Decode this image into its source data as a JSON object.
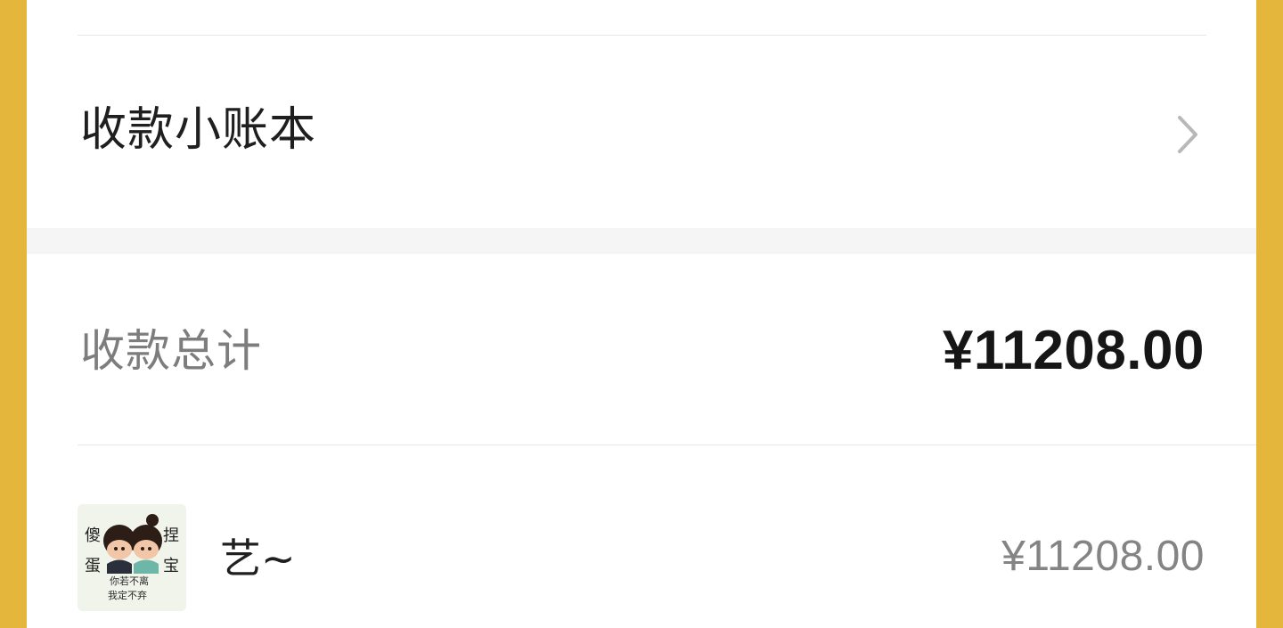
{
  "ledger": {
    "label": "收款小账本",
    "chevron_icon": "chevron-right-icon"
  },
  "summary": {
    "label": "收款总计",
    "amount": "¥11208.00"
  },
  "payers": [
    {
      "name": "艺~",
      "amount": "¥11208.00",
      "avatar": {
        "icon": "cartoon-couple-avatar",
        "left_text": "傻蛋",
        "right_text": "捏宝",
        "caption_line1": "你若不离",
        "caption_line2": "我定不弃"
      }
    }
  ],
  "colors": {
    "frame": "#e4b73c",
    "card": "#ffffff",
    "section_gap": "#f5f5f5",
    "divider": "#e7e7e7",
    "primary_text": "#1f1f1f",
    "secondary_text": "#7d7d7d"
  }
}
